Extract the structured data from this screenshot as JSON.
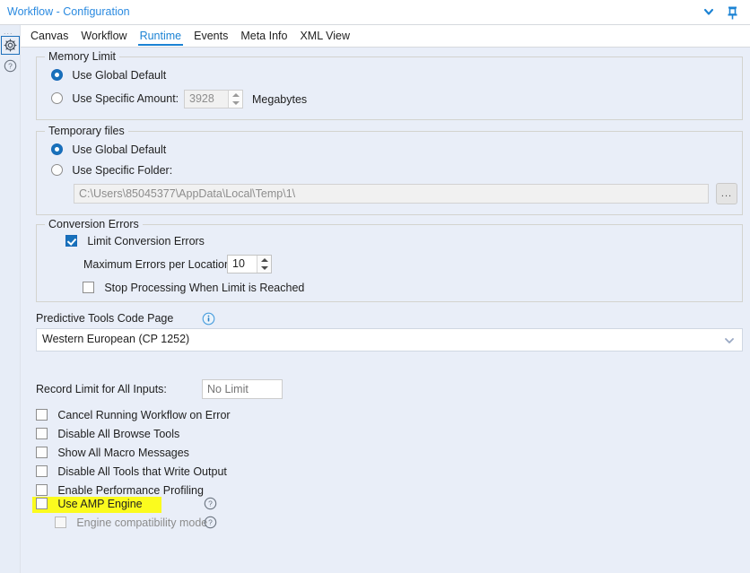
{
  "titlebar": {
    "title": "Workflow - Configuration",
    "chevron_icon": "chevron-down-icon",
    "pin_icon": "pin-icon"
  },
  "rail": {
    "dots": "...",
    "gear_icon": "gear-icon",
    "help_icon": "question-circle-icon"
  },
  "tabs": [
    {
      "label": "Canvas",
      "active": false
    },
    {
      "label": "Workflow",
      "active": false
    },
    {
      "label": "Runtime",
      "active": true
    },
    {
      "label": "Events",
      "active": false
    },
    {
      "label": "Meta Info",
      "active": false
    },
    {
      "label": "XML View",
      "active": false
    }
  ],
  "memory_limit": {
    "group_title": "Memory Limit",
    "option_global": "Use Global Default",
    "option_specific": "Use Specific Amount:",
    "selected": "global",
    "amount_value": "3928",
    "amount_disabled": true,
    "unit_label": "Megabytes"
  },
  "temporary_files": {
    "group_title": "Temporary files",
    "option_global": "Use Global Default",
    "option_specific": "Use Specific Folder:",
    "selected": "global",
    "folder_path": "C:\\Users\\85045377\\AppData\\Local\\Temp\\1\\",
    "folder_disabled": true,
    "browse_label": "..."
  },
  "conversion_errors": {
    "group_title": "Conversion Errors",
    "limit_label": "Limit Conversion Errors",
    "limit_checked": true,
    "max_errors_label": "Maximum Errors per Location:",
    "max_errors_value": "10",
    "stop_label": "Stop Processing When Limit is Reached",
    "stop_checked": false
  },
  "code_page": {
    "label": "Predictive Tools Code Page",
    "info_icon": "info-circle-icon",
    "value": "Western European (CP 1252)",
    "chevron_icon": "chevron-down-icon"
  },
  "record_limit": {
    "label": "Record Limit for All Inputs:",
    "value": "",
    "placeholder": "No Limit"
  },
  "options": [
    {
      "label": "Cancel Running Workflow on Error",
      "checked": false
    },
    {
      "label": "Disable All Browse Tools",
      "checked": false
    },
    {
      "label": "Show All Macro Messages",
      "checked": false
    },
    {
      "label": "Disable All Tools that Write Output",
      "checked": false
    },
    {
      "label": "Enable Performance Profiling",
      "checked": false
    }
  ],
  "amp": {
    "use_amp_label": "Use AMP Engine",
    "use_amp_checked": false,
    "use_amp_help_icon": "question-circle-icon",
    "compat_label": "Engine compatibility mode",
    "compat_checked": false,
    "compat_disabled": true,
    "compat_help_icon": "question-circle-icon",
    "highlight_color": "#fbfb1e"
  },
  "colors": {
    "accent": "#1c83d4",
    "background": "#e9eef8",
    "titlebar": "#ffffff",
    "group_border": "#d3d3ce",
    "highlight": "#fbfb1e"
  }
}
